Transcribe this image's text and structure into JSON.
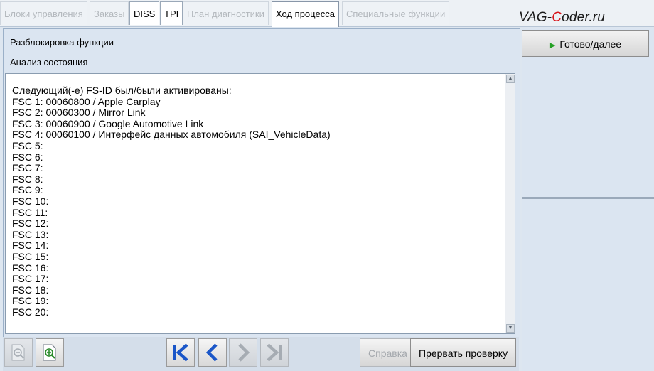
{
  "tabs": [
    {
      "label": "Блоки управления",
      "state": "disabled"
    },
    {
      "label": "Заказы",
      "state": "disabled"
    },
    {
      "label": "DISS",
      "state": "enabled"
    },
    {
      "label": "TPI",
      "state": "enabled"
    },
    {
      "label": "План диагностики",
      "state": "disabled"
    },
    {
      "label": "Ход процесса",
      "state": "active"
    },
    {
      "label": "Специальные функции",
      "state": "disabled"
    }
  ],
  "watermark": {
    "part1": "VAG-",
    "part2": "C",
    "part3": "oder.ru"
  },
  "main": {
    "label_unlock": "Разблокировка функции",
    "label_status": "Анализ состояния",
    "output_lines": [
      "Следующий(-е) FS-ID был/были активированы:",
      "FSC 1: 00060800 / Apple Carplay",
      "FSC 2: 00060300 / Mirror Link",
      "FSC 3: 00060900 / Google Automotive Link",
      "FSC 4: 00060100 / Интерфейс данных автомобиля (SAI_VehicleData)",
      "FSC 5:",
      "FSC 6:",
      "FSC 7:",
      "FSC 8:",
      "FSC 9:",
      "FSC 10:",
      "FSC 11:",
      "FSC 12:",
      "FSC 13:",
      "FSC 14:",
      "FSC 15:",
      "FSC 16:",
      "FSC 17:",
      "FSC 18:",
      "FSC 19:",
      "FSC 20:"
    ]
  },
  "right": {
    "done_label": "Готово/далее"
  },
  "bottom": {
    "help_label": "Справка",
    "abort_label": "Прервать проверку"
  },
  "colors": {
    "accent_blue": "#1a56c8",
    "play_green": "#24a024",
    "watermark_red": "#d8141a"
  }
}
